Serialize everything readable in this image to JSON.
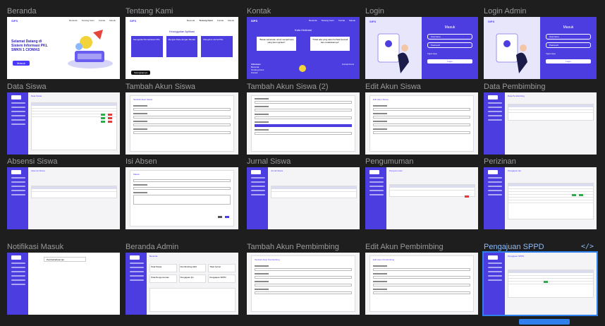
{
  "frames": [
    {
      "id": "beranda",
      "label": "Beranda"
    },
    {
      "id": "tentang",
      "label": "Tentang Kami"
    },
    {
      "id": "kontak",
      "label": "Kontak"
    },
    {
      "id": "login",
      "label": "Login"
    },
    {
      "id": "login-admin",
      "label": "Login Admin"
    },
    {
      "id": "data-siswa",
      "label": "Data Siswa"
    },
    {
      "id": "tambah-akun-siswa",
      "label": "Tambah Akun Siswa"
    },
    {
      "id": "tambah-akun-siswa-2",
      "label": "Tambah Akun Siswa (2)"
    },
    {
      "id": "edit-akun-siswa",
      "label": "Edit Akun Siswa"
    },
    {
      "id": "data-pembimbing",
      "label": "Data Pembimbing"
    },
    {
      "id": "absensi-siswa",
      "label": "Absensi Siswa"
    },
    {
      "id": "isi-absen",
      "label": "Isi Absen"
    },
    {
      "id": "jurnal-siswa",
      "label": "Jurnal Siswa"
    },
    {
      "id": "pengumuman",
      "label": "Pengumuman"
    },
    {
      "id": "perizinan",
      "label": "Perizinan"
    },
    {
      "id": "notifikasi-masuk",
      "label": "Notifikasi Masuk"
    },
    {
      "id": "beranda-admin",
      "label": "Beranda Admin"
    },
    {
      "id": "tambah-akun-pembimbing",
      "label": "Tambah Akun Pembimbing"
    },
    {
      "id": "edit-akun-pembimbing",
      "label": "Edit Akun Pembimbing"
    },
    {
      "id": "pengajuan-sppd",
      "label": "Pengajuan SPPD"
    }
  ],
  "selected_frame": "Pengajuan SPPD",
  "code_icon": "</>",
  "beranda": {
    "logo": "SIPS",
    "nav": [
      "Beranda",
      "Tentang Kami",
      "Kontak",
      "Masuk"
    ],
    "hero_line1": "Selamat Datang di",
    "hero_line2": "Sistem Informasi PKL",
    "hero_line3": "SMKN 1 CIOMAS",
    "cta": "Masuk"
  },
  "tentang": {
    "logo": "SIPS",
    "nav": [
      "Beranda",
      "Tentang Kami",
      "Kontak",
      "Masuk"
    ],
    "heading": "Keunggulan Aplikasi",
    "cards": [
      "Mengelola Pemantauan PKL",
      "Mengisi Data dengan Mudah",
      "Mengirimi Jurnal PKL"
    ],
    "button": "Selengkapnya"
  },
  "kontak": {
    "logo": "SIPS",
    "nav": [
      "Beranda",
      "Tentang Kami",
      "Kontak",
      "Masuk"
    ],
    "heading": "Kata Motivasi",
    "quote1": "\"Bukan kebetulan untuk menjadi apa yang kau inginkan\"",
    "quote2": "\"Tidak ada yang akan berhasil kecuali kau melakukannya\"",
    "footer_left": "Informasi",
    "footer_items": [
      "Beranda",
      "Tentang Kami",
      "Kontak"
    ],
    "footer_right": "Kontak Kami"
  },
  "login": {
    "logo": "SIPS",
    "title": "Masuk",
    "username": "Username",
    "password": "Password",
    "remember": "Ingat saya",
    "button": "Login"
  },
  "sidebar_logo": "SIPS",
  "page_titles": {
    "data_siswa": "Data Siswa",
    "tambah_siswa": "Tambah Akun Siswa",
    "edit_siswa": "Edit Akun Siswa",
    "data_pembimbing": "Data Pembimbing",
    "absensi": "Absensi Siswa",
    "isi_absen": "Masuk",
    "jurnal": "Jurnal Siswa",
    "pengumuman": "Pengumuman",
    "perizinan": "Pengajuan Ijin",
    "notif": "Pemberitahuan Ijin",
    "beranda_admin": "Beranda",
    "tambah_pembimbing": "Tambah Akun Pembimbing",
    "edit_pembimbing": "Edit Akun Pembimbing",
    "sppd": "Pengajuan SPPD"
  },
  "admin_stats": [
    "Total Siswa",
    "Pembimbing Aktif",
    "Total Jurnal",
    "Total Pengumuman",
    "Pengajuan Ijin",
    "Pengajuan SPPD"
  ]
}
